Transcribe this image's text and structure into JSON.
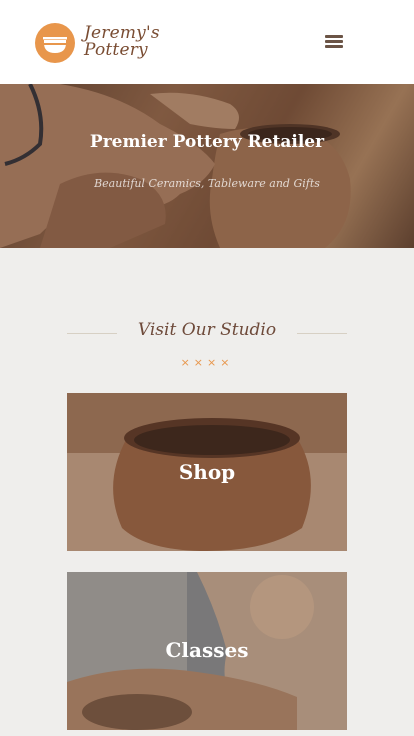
{
  "brand": {
    "name_line1": "Jeremy's",
    "name_line2": "Pottery",
    "logo_icon": "bowl-icon",
    "accent_color": "#e8964b"
  },
  "header": {
    "menu_icon": "hamburger-menu-icon"
  },
  "hero": {
    "title": "Premier Pottery Retailer",
    "subtitle": "Beautiful Ceramics, Tableware and Gifts"
  },
  "studio": {
    "title": "Visit Our Studio",
    "divider": "××××"
  },
  "cards": [
    {
      "label": "Shop"
    },
    {
      "label": "Classes"
    }
  ]
}
